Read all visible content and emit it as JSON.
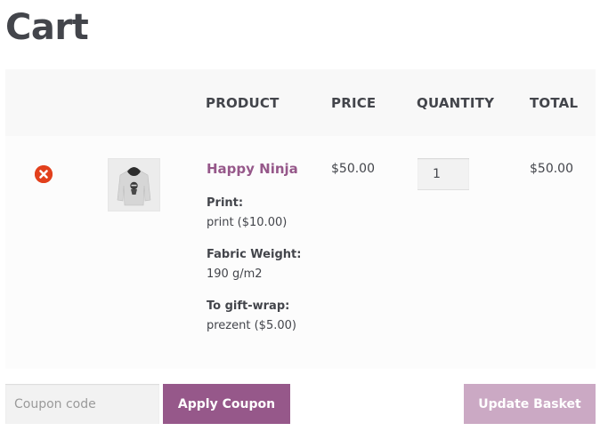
{
  "page": {
    "title": "Cart"
  },
  "table": {
    "headers": {
      "product": "PRODUCT",
      "price": "PRICE",
      "quantity": "QUANTITY",
      "total": "TOTAL"
    },
    "rows": [
      {
        "product_name": "Happy Ninja",
        "thumbnail_icon": "hoodie-image",
        "remove_icon": "remove-x-icon",
        "meta": [
          {
            "label": "Print:",
            "value": "print ($10.00)"
          },
          {
            "label": "Fabric Weight:",
            "value": "190 g/m2"
          },
          {
            "label": "To gift-wrap:",
            "value": "prezent ($5.00)"
          }
        ],
        "price": "$50.00",
        "quantity": "1",
        "total": "$50.00"
      }
    ]
  },
  "actions": {
    "coupon_placeholder": "Coupon code",
    "apply_coupon": "Apply Coupon",
    "update_basket": "Update Basket"
  },
  "colors": {
    "accent": "#96588a",
    "accent_disabled": "#cba9c4",
    "remove": "#e2401c",
    "text": "#43454b"
  }
}
